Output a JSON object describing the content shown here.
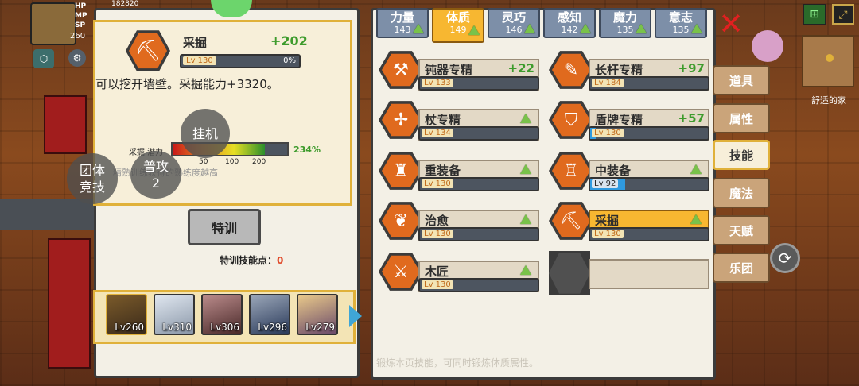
{
  "player": {
    "stats": [
      "HP",
      "MP",
      "SP"
    ],
    "level": "260",
    "gold_partial": "182820"
  },
  "detail": {
    "skill_name": "采掘",
    "bonus": "+202",
    "level": "Lv 130",
    "progress": "0%",
    "description": "可以挖开墙壁。采掘能力+3320。",
    "potential_label": "采掘 潜力",
    "potential_percent": "234%",
    "potential_ticks": [
      "50",
      "100",
      "200"
    ],
    "hint": "精熟训练获得的熟练度越高",
    "train_button": "特训",
    "train_points_label": "特训技能点：",
    "train_points": "0"
  },
  "float_buttons": {
    "afk": "挂机",
    "team_arena": "团体\n竞技",
    "basic_attack": "普攻\n2"
  },
  "party": [
    {
      "level": "Lv260"
    },
    {
      "level": "Lv310"
    },
    {
      "level": "Lv306"
    },
    {
      "level": "Lv296"
    },
    {
      "level": "Lv279"
    }
  ],
  "attributes": [
    {
      "name": "力量",
      "value": "143"
    },
    {
      "name": "体质",
      "value": "149"
    },
    {
      "name": "灵巧",
      "value": "146"
    },
    {
      "name": "感知",
      "value": "142"
    },
    {
      "name": "魔力",
      "value": "135"
    },
    {
      "name": "意志",
      "value": "135"
    }
  ],
  "skills": [
    {
      "name": "钝器专精",
      "level": "Lv 133",
      "bonus": "+22",
      "icon": "hammer-icon",
      "glyph": "⚒",
      "fill": 0.0
    },
    {
      "name": "长杆专精",
      "level": "Lv 184",
      "bonus": "+97",
      "icon": "spear-icon",
      "glyph": "✎",
      "fill": 0.0
    },
    {
      "name": "杖专精",
      "level": "Lv 134",
      "bonus": "",
      "icon": "staff-icon",
      "glyph": "✢",
      "fill": 0.0
    },
    {
      "name": "盾牌专精",
      "level": "Lv 130",
      "bonus": "+57",
      "icon": "shield-icon",
      "glyph": "⛉",
      "fill": 0.05
    },
    {
      "name": "重装备",
      "level": "Lv 130",
      "bonus": "",
      "icon": "heavy-armor-icon",
      "glyph": "♜",
      "fill": 0.0
    },
    {
      "name": "中装备",
      "level": "Lv 92",
      "bonus": "",
      "icon": "medium-armor-icon",
      "glyph": "♖",
      "fill": 0.3
    },
    {
      "name": "治愈",
      "level": "Lv 130",
      "bonus": "",
      "icon": "heal-icon",
      "glyph": "❦",
      "fill": 0.0
    },
    {
      "name": "采掘",
      "level": "Lv 130",
      "bonus": "",
      "icon": "pickaxe-icon",
      "glyph": "⛏",
      "fill": 0.0
    },
    {
      "name": "木匠",
      "level": "Lv 130",
      "bonus": "",
      "icon": "saw-icon",
      "glyph": "⚔",
      "fill": 0.0
    }
  ],
  "footer_hint": "锻炼本页技能，可同时锻炼体质属性。",
  "side_tabs": [
    "道具",
    "属性",
    "技能",
    "魔法",
    "天赋",
    "乐团"
  ],
  "location": "舒适的家",
  "colors": {
    "accent": "#f7b731",
    "bonus_green": "#3d9b2c",
    "skill_hex": "#e06a1e"
  }
}
